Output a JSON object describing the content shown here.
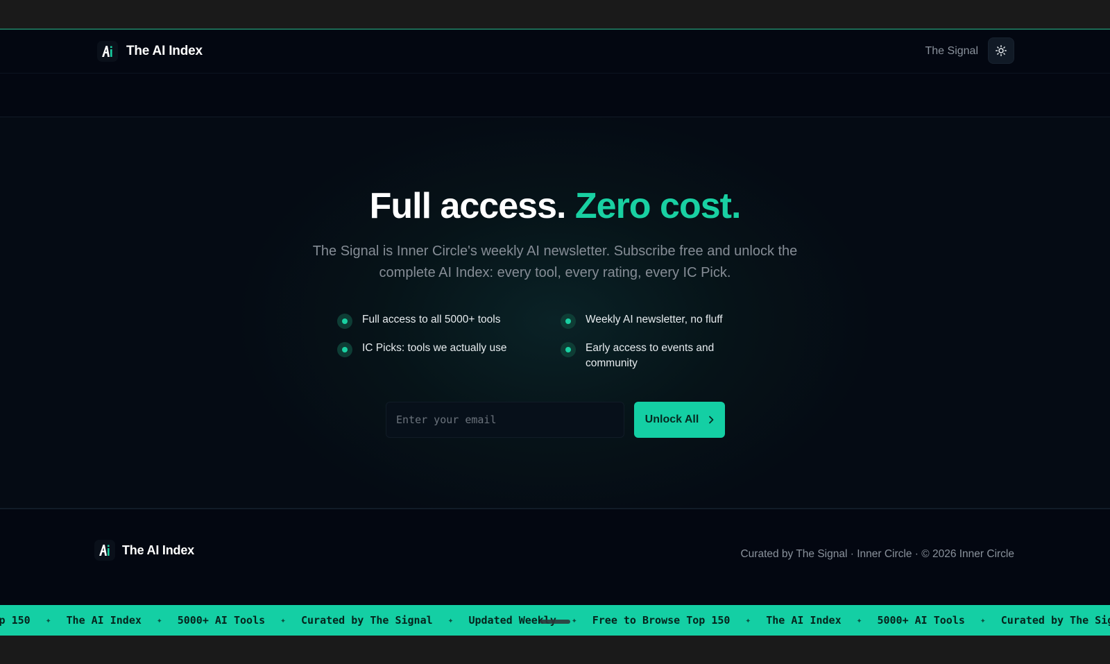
{
  "header": {
    "brand": "The AI Index",
    "nav_link": "The Signal",
    "theme_toggle_icon": "sun-icon"
  },
  "hero": {
    "title_main": "Full access.",
    "title_accent": "Zero cost.",
    "subtitle": "The Signal is Inner Circle's weekly AI newsletter. Subscribe free and unlock the complete AI Index: every tool, every rating, every IC Pick.",
    "features": [
      "Full access to all 5000+ tools",
      "Weekly AI newsletter, no fluff",
      "IC Picks: tools we actually use",
      "Early access to events and community"
    ],
    "email_placeholder": "Enter your email",
    "email_value": "",
    "cta_label": "Unlock All"
  },
  "footer": {
    "brand": "The AI Index",
    "copy": "Curated by The Signal · Inner Circle · © 2026 Inner Circle"
  },
  "ticker": {
    "items": [
      "Free to Browse Top 150",
      "The AI Index",
      "5000+ AI Tools",
      "Curated by The Signal",
      "Updated Weekly",
      "Free to Browse Top 150",
      "The AI Index",
      "5000+ AI Tools",
      "Curated by The Signal"
    ]
  },
  "colors": {
    "accent": "#14cfa4",
    "background": "#030711",
    "text_muted": "#868d96"
  }
}
